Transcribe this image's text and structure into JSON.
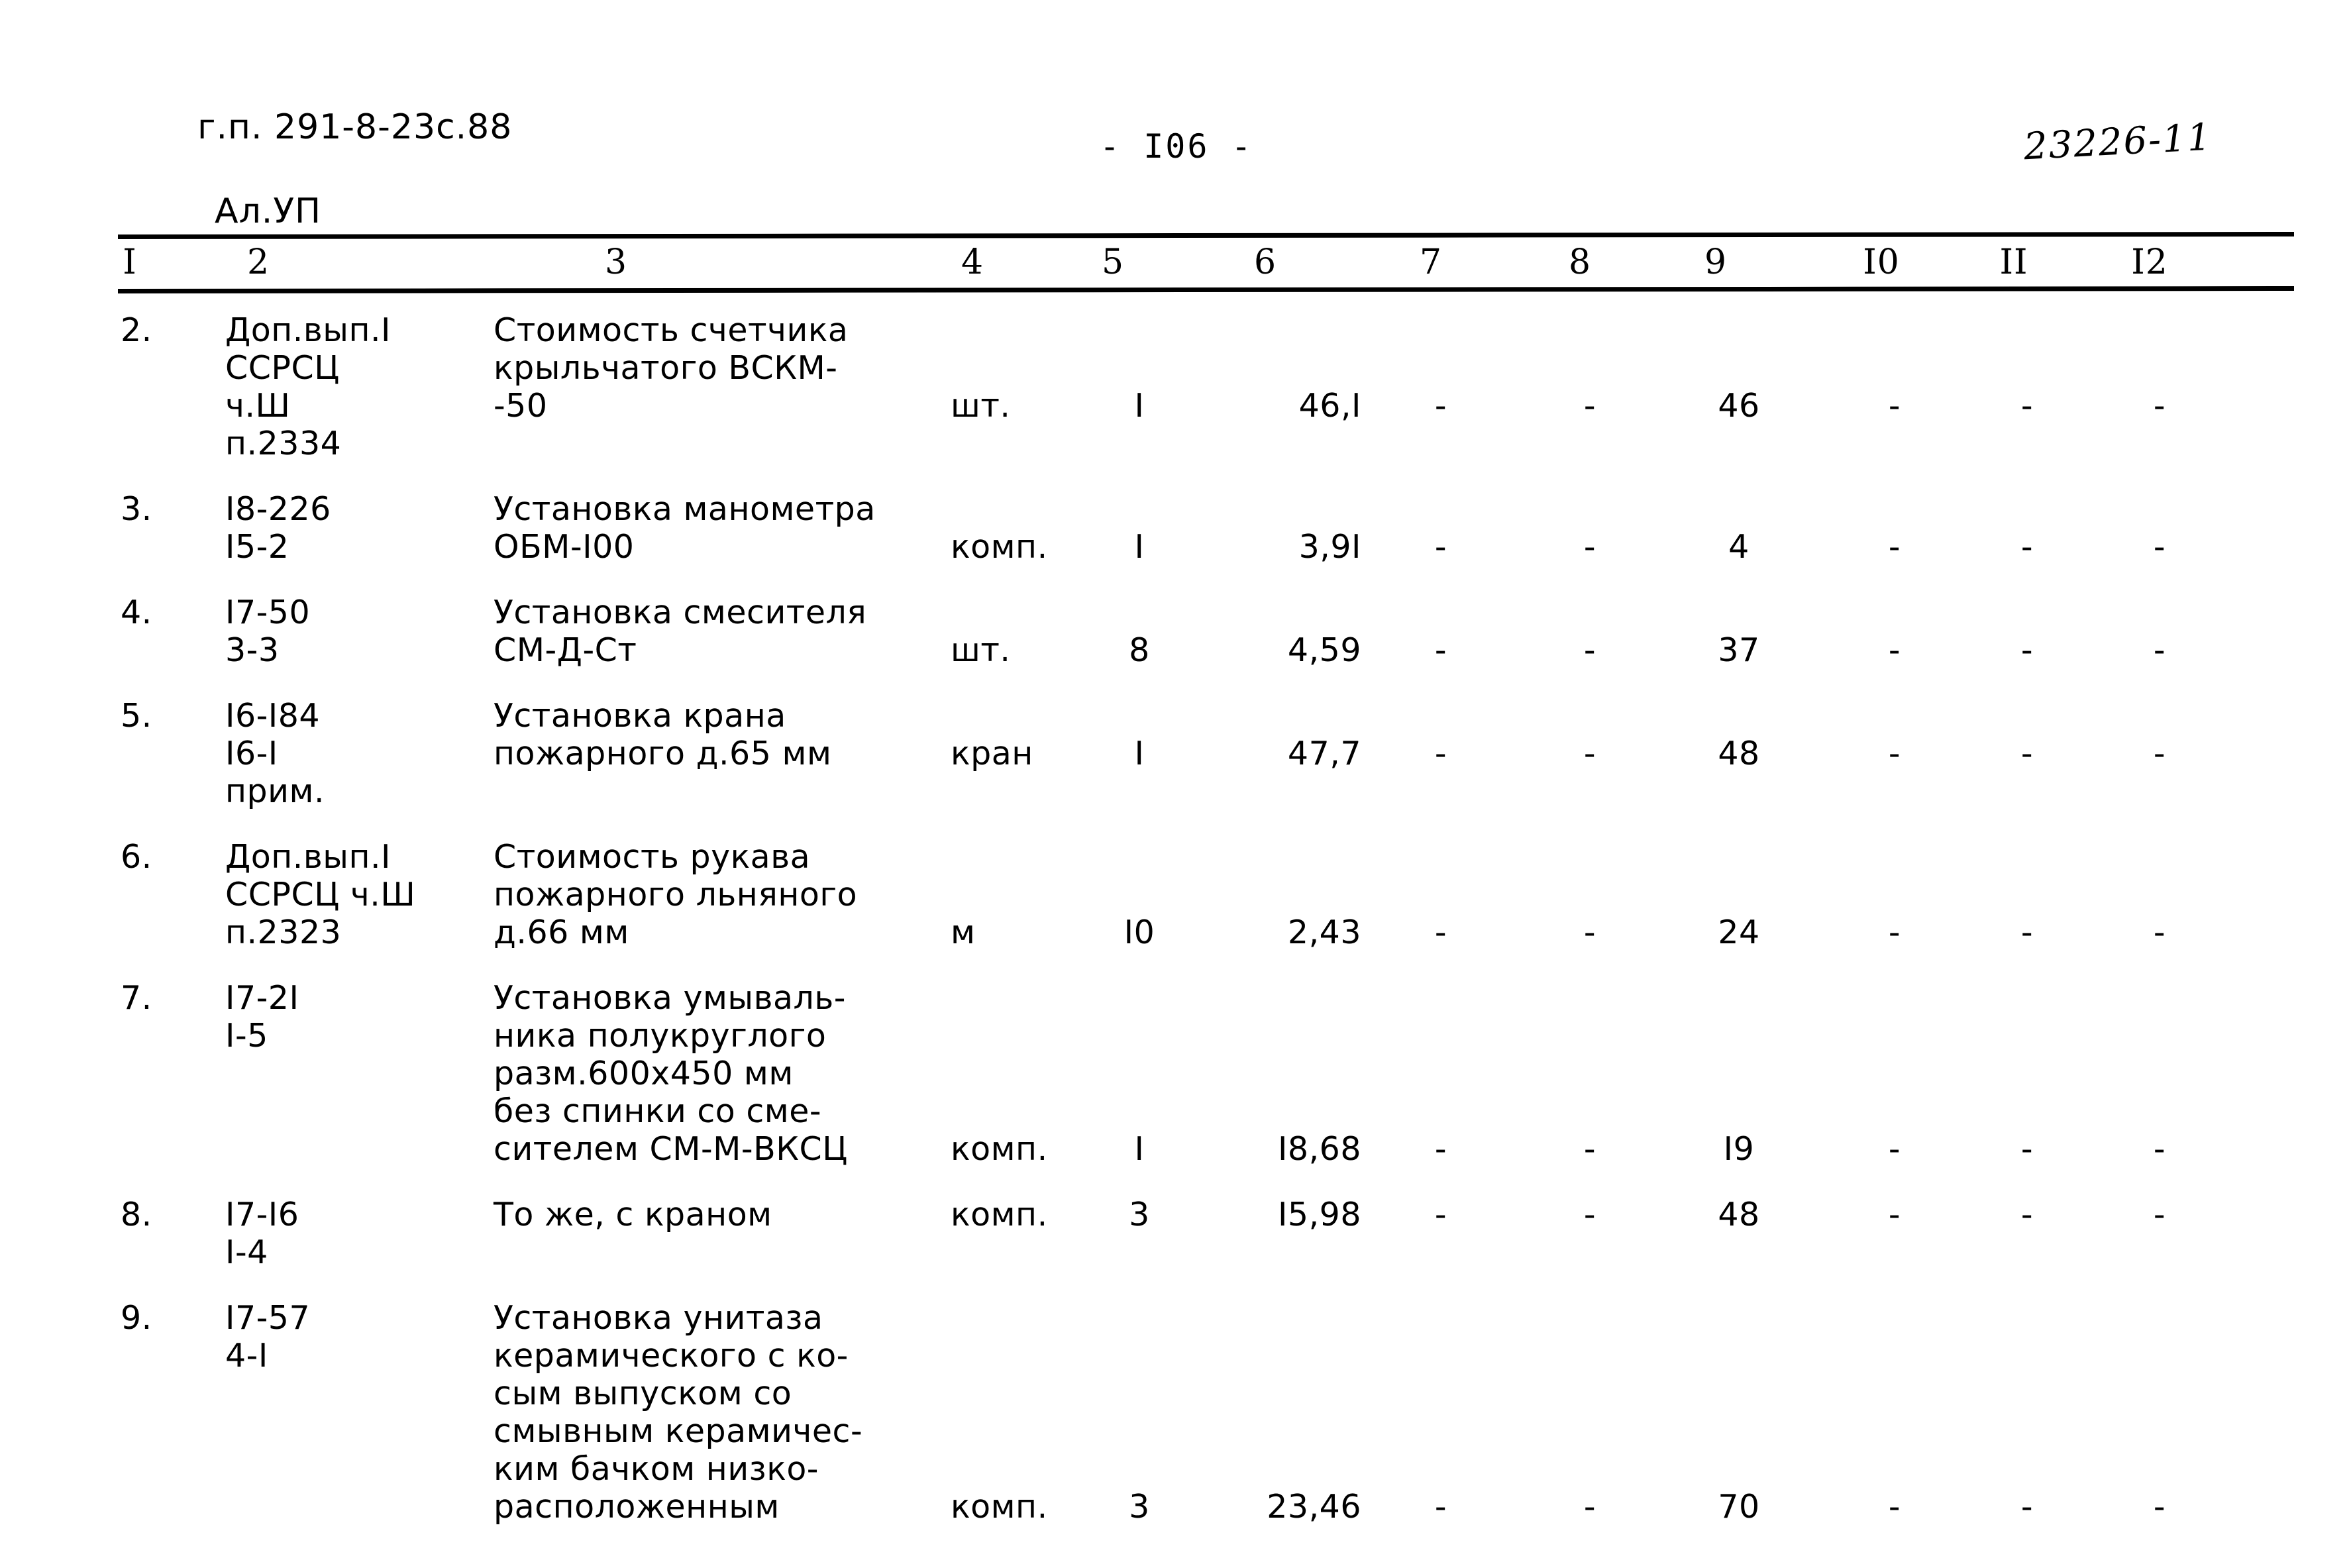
{
  "header": {
    "doc_code_line1": "г.п. 291-8-23с.88",
    "doc_code_line2": "Ал.УП",
    "page_number": "- I06 -",
    "archive_number": "23226-11"
  },
  "table": {
    "column_numbers": [
      "I",
      "2",
      "3",
      "4",
      "5",
      "6",
      "7",
      "8",
      "9",
      "I0",
      "II",
      "I2"
    ],
    "rows": [
      {
        "num": "2.",
        "code": "Доп.вып.I\nССРСЦ\nч.Ш\nп.2334",
        "desc": "Стоимость счетчика\nкрыльчатого ВСКМ-\n-50",
        "unit": "шт.",
        "qty": "I",
        "v6": "46,I",
        "v7": "-",
        "v8": "-",
        "v9": "46",
        "v10": "-",
        "v11": "-",
        "v12": "-",
        "value_line": 2
      },
      {
        "num": "3.",
        "code": "I8-226\nI5-2",
        "desc": "Установка манометра\nОБМ-I00",
        "unit": "комп.",
        "qty": "I",
        "v6": "3,9I",
        "v7": "-",
        "v8": "-",
        "v9": "4",
        "v10": "-",
        "v11": "-",
        "v12": "-",
        "value_line": 1
      },
      {
        "num": "4.",
        "code": "I7-50\n3-3",
        "desc": "Установка смесителя\nСМ-Д-Ст",
        "unit": "шт.",
        "qty": "8",
        "v6": "4,59",
        "v7": "-",
        "v8": "-",
        "v9": "37",
        "v10": "-",
        "v11": "-",
        "v12": "-",
        "value_line": 1
      },
      {
        "num": "5.",
        "code": "I6-I84\nI6-I\nприм.",
        "desc": "Установка крана\nпожарного д.65 мм",
        "unit": "кран",
        "qty": "I",
        "v6": "47,7",
        "v7": "-",
        "v8": "-",
        "v9": "48",
        "v10": "-",
        "v11": "-",
        "v12": "-",
        "value_line": 1
      },
      {
        "num": "6.",
        "code": "Доп.вып.I\nССРСЦ ч.Ш\nп.2323",
        "desc": "Стоимость рукава\nпожарного льняного\nд.66 мм",
        "unit": "м",
        "qty": "I0",
        "v6": "2,43",
        "v7": "-",
        "v8": "-",
        "v9": "24",
        "v10": "-",
        "v11": "-",
        "v12": "-",
        "value_line": 2
      },
      {
        "num": "7.",
        "code": "I7-2I\nI-5",
        "desc": "Установка умываль-\nника полукруглого\nразм.600х450 мм\nбез спинки со сме-\nсителем СМ-М-ВКСЦ",
        "unit": "комп.",
        "qty": "I",
        "v6": "I8,68",
        "v7": "-",
        "v8": "-",
        "v9": "I9",
        "v10": "-",
        "v11": "-",
        "v12": "-",
        "value_line": 4
      },
      {
        "num": "8.",
        "code": "I7-I6\nI-4",
        "desc": "То же, с краном",
        "unit": "комп.",
        "qty": "3",
        "v6": "I5,98",
        "v7": "-",
        "v8": "-",
        "v9": "48",
        "v10": "-",
        "v11": "-",
        "v12": "-",
        "value_line": 0
      },
      {
        "num": "9.",
        "code": "I7-57\n4-I",
        "desc": "Установка унитаза\nкерамического с ко-\nсым выпуском со\nсмывным керамичес-\nким бачком низко-\nрасположенным",
        "unit": "комп.",
        "qty": "3",
        "v6": "23,46",
        "v7": "-",
        "v8": "-",
        "v9": "70",
        "v10": "-",
        "v11": "-",
        "v12": "-",
        "value_line": 5
      }
    ]
  }
}
